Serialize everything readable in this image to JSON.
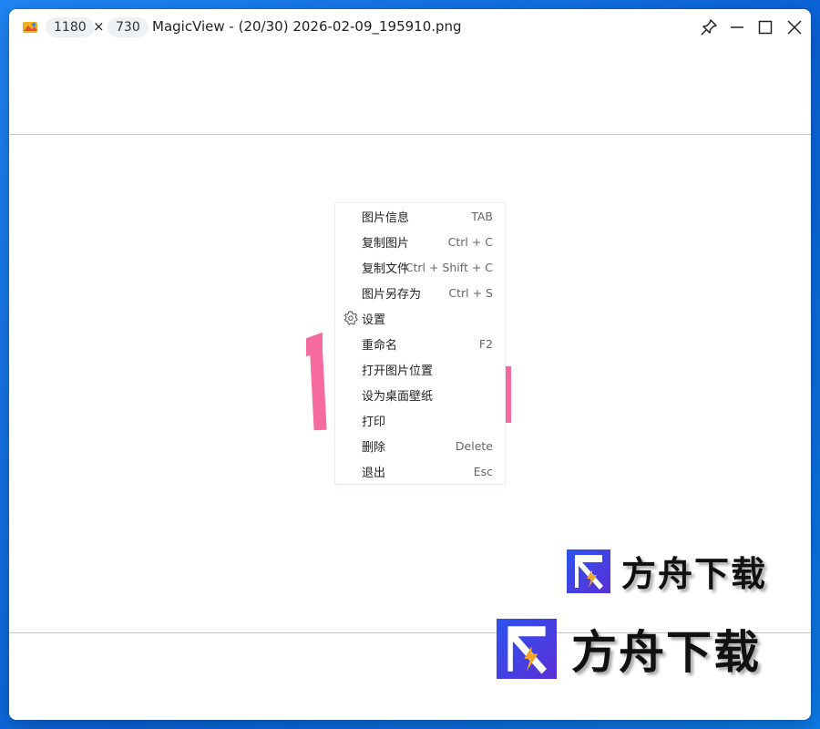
{
  "window": {
    "width_label": "1180",
    "times_label": "×",
    "height_label": "730",
    "title": "MagicView - (20/30) 2026-02-09_195910.png"
  },
  "titlebar_buttons": [
    "pin-icon",
    "minimize-icon",
    "maximize-icon",
    "close-icon"
  ],
  "context_menu": {
    "items": [
      {
        "label": "图片信息",
        "shortcut": "TAB"
      },
      {
        "label": "复制图片",
        "shortcut": "Ctrl + C"
      },
      {
        "label": "复制文件",
        "shortcut": "Ctrl + Shift + C"
      },
      {
        "label": "图片另存为",
        "shortcut": "Ctrl + S"
      },
      {
        "label": "设置",
        "shortcut": "",
        "icon": "gear-icon"
      },
      {
        "label": "重命名",
        "shortcut": "F2"
      },
      {
        "label": "打开图片位置",
        "shortcut": ""
      },
      {
        "label": "设为桌面壁纸",
        "shortcut": ""
      },
      {
        "label": "打印",
        "shortcut": ""
      },
      {
        "label": "删除",
        "shortcut": "Delete"
      },
      {
        "label": "退出",
        "shortcut": "Esc"
      }
    ]
  },
  "watermark": {
    "text": "方舟下载"
  },
  "colors": {
    "desktop": "#1f86f5",
    "pink_stroke": "#f56ba0",
    "logo_blue": "#3b3fe0",
    "logo_lightning": "#f5a623"
  }
}
